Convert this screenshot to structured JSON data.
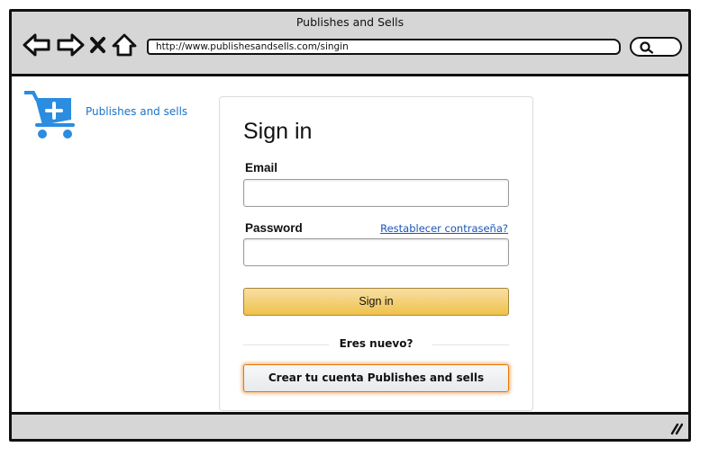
{
  "window": {
    "title": "Publishes and Sells",
    "url": "http://www.publishesandsells.com/singin"
  },
  "brand": {
    "name": "Publishes and sells",
    "logo_icon": "shopping-cart-add-icon",
    "accent_color": "#2a8de0"
  },
  "nav": {
    "back_icon": "arrow-left-icon",
    "forward_icon": "arrow-right-icon",
    "stop_icon": "close-icon",
    "home_icon": "home-icon",
    "search_icon": "search-icon"
  },
  "signin": {
    "title": "Sign in",
    "email_label": "Email",
    "email_value": "",
    "password_label": "Password",
    "password_value": "",
    "forgot_link": "Restablecer contraseña?",
    "submit_label": "Sign in",
    "divider_text": "Eres nuevo?",
    "create_label": "Crear tu cuenta Publishes and sells"
  },
  "colors": {
    "button_primary": "#f0c14b",
    "button_secondary_border": "#e77600",
    "link": "#1a55b8",
    "chrome": "#d6d6d6"
  }
}
